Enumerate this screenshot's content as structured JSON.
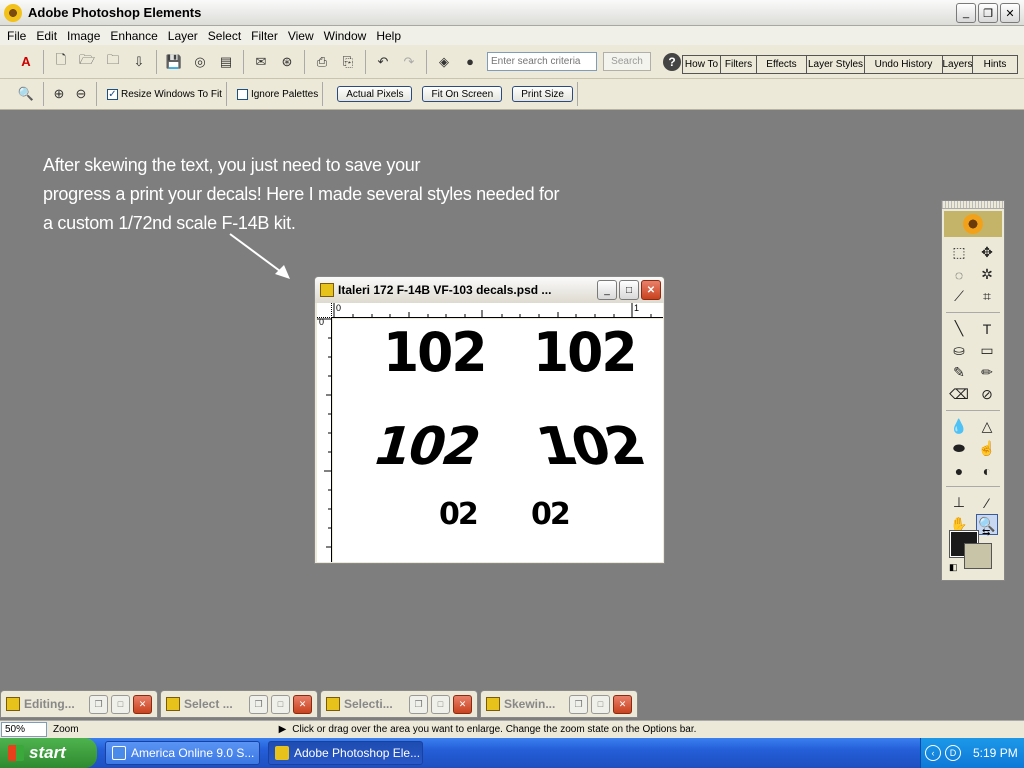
{
  "app": {
    "title": "Adobe Photoshop Elements"
  },
  "menu": [
    "File",
    "Edit",
    "Image",
    "Enhance",
    "Layer",
    "Select",
    "Filter",
    "View",
    "Window",
    "Help"
  ],
  "search": {
    "placeholder": "Enter search criteria",
    "button": "Search"
  },
  "palette_tabs": [
    "How To",
    "Filters",
    "Effects",
    "Layer Styles",
    "Undo History",
    "Layers",
    "Hints"
  ],
  "options": {
    "resize_label": "Resize Windows To Fit",
    "ignore_label": "Ignore Palettes",
    "actual_pixels": "Actual Pixels",
    "fit_on_screen": "Fit On Screen",
    "print_size": "Print Size"
  },
  "caption": {
    "lines": [
      "After skewing the text, you just need to save your",
      "progress a print your decals!  Here I made several styles needed for",
      "a custom 1/72nd scale F-14B kit."
    ]
  },
  "document": {
    "title": "Italeri 172 F-14B VF-103 decals.psd ...",
    "ruler_top": {
      "zero": "0",
      "one": "1"
    },
    "ruler_left": {
      "zero": "0"
    },
    "decals": [
      "102",
      "102",
      "102",
      "102",
      "02",
      "02"
    ]
  },
  "minimized_docs": [
    "Editing...",
    "Select ...",
    "Selecti...",
    "Skewin..."
  ],
  "status": {
    "zoom": "50%",
    "zoom_label": "Zoom",
    "text": "Click or drag over the area you want to enlarge. Change the zoom state on the Options bar."
  },
  "taskbar": {
    "start": "start",
    "tasks": [
      "America Online 9.0 S...",
      "Adobe Photoshop Ele..."
    ],
    "clock": "5:19 PM"
  }
}
